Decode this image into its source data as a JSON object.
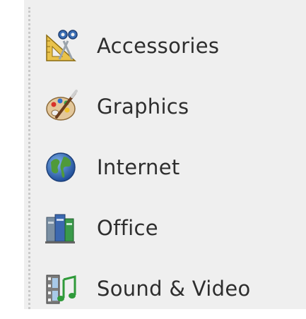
{
  "menu": {
    "items": [
      {
        "label": "Accessories",
        "icon": "accessories-icon"
      },
      {
        "label": "Graphics",
        "icon": "graphics-icon"
      },
      {
        "label": "Internet",
        "icon": "internet-icon"
      },
      {
        "label": "Office",
        "icon": "office-icon"
      },
      {
        "label": "Sound & Video",
        "icon": "sound-video-icon"
      }
    ]
  }
}
